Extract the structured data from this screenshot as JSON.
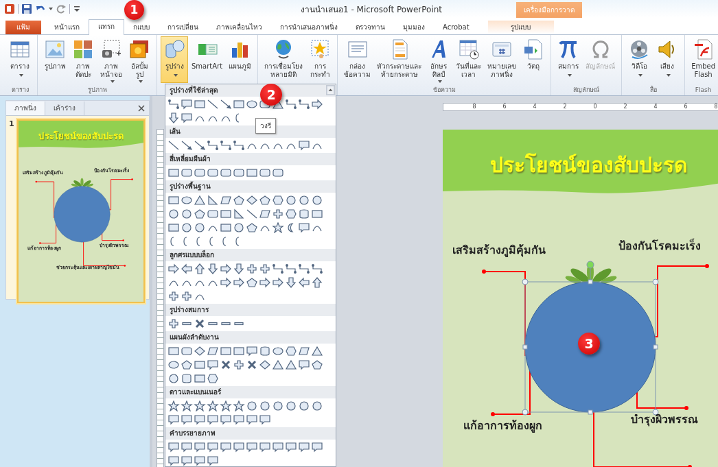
{
  "window": {
    "title": "งานนำเสนอ1 - Microsoft PowerPoint"
  },
  "contextual_group": {
    "label": "เครื่องมือการวาด"
  },
  "tabs": [
    {
      "label": "แฟ้ม",
      "kind": "file",
      "selected": false
    },
    {
      "label": "หน้าแรก",
      "kind": "normal",
      "selected": false
    },
    {
      "label": "แทรก",
      "kind": "normal",
      "selected": true
    },
    {
      "label": "กแบบ",
      "kind": "normal",
      "selected": false
    },
    {
      "label": "การเปลี่ยน",
      "kind": "normal",
      "selected": false
    },
    {
      "label": "ภาพเคลื่อนไหว",
      "kind": "normal",
      "selected": false
    },
    {
      "label": "การนำเสนอภาพนิ่ง",
      "kind": "normal",
      "selected": false
    },
    {
      "label": "ตรวจทาน",
      "kind": "normal",
      "selected": false
    },
    {
      "label": "มุมมอง",
      "kind": "normal",
      "selected": false
    },
    {
      "label": "Acrobat",
      "kind": "normal",
      "selected": false
    },
    {
      "label": "รูปแบบ",
      "kind": "contextual",
      "selected": false
    }
  ],
  "ribbon": {
    "groups": [
      {
        "label": "ตาราง",
        "buttons": [
          {
            "lines": [
              "ตาราง"
            ],
            "dropdown": true,
            "pressed": false,
            "disabled": false
          }
        ]
      },
      {
        "label": "รูปภาพ",
        "buttons": [
          {
            "lines": [
              "รูปภาพ"
            ],
            "dropdown": false,
            "pressed": false,
            "disabled": false
          },
          {
            "lines": [
              "ภาพ",
              "ตัดปะ"
            ],
            "dropdown": false,
            "pressed": false,
            "disabled": false
          },
          {
            "lines": [
              "ภาพ",
              "หน้าจอ"
            ],
            "dropdown": true,
            "pressed": false,
            "disabled": false
          },
          {
            "lines": [
              "อัลบั้ม",
              "รูป"
            ],
            "dropdown": true,
            "pressed": false,
            "disabled": false
          }
        ]
      },
      {
        "buttons": [
          {
            "lines": [
              "รูปร่าง"
            ],
            "dropdown": true,
            "pressed": true,
            "disabled": false
          },
          {
            "lines": [
              "SmartArt"
            ],
            "dropdown": false,
            "pressed": false,
            "disabled": false
          },
          {
            "lines": [
              "แผนภูมิ"
            ],
            "dropdown": false,
            "pressed": false,
            "disabled": false
          }
        ]
      },
      {
        "buttons": [
          {
            "lines": [
              "การเชื่อมโยง",
              "หลายมิติ"
            ],
            "dropdown": false,
            "pressed": false,
            "disabled": false
          },
          {
            "lines": [
              "การ",
              "กระทำ"
            ],
            "dropdown": false,
            "pressed": false,
            "disabled": false
          }
        ]
      },
      {
        "label": "ข้อความ",
        "buttons": [
          {
            "lines": [
              "กล่อง",
              "ข้อความ"
            ],
            "dropdown": false,
            "pressed": false,
            "disabled": false
          },
          {
            "lines": [
              "หัวกระดาษและ",
              "ท้ายกระดาษ"
            ],
            "dropdown": false,
            "pressed": false,
            "disabled": false
          },
          {
            "lines": [
              "อักษร",
              "ศิลป์"
            ],
            "dropdown": true,
            "pressed": false,
            "disabled": false
          },
          {
            "lines": [
              "วันที่และ",
              "เวลา"
            ],
            "dropdown": false,
            "pressed": false,
            "disabled": false
          },
          {
            "lines": [
              "หมายเลข",
              "ภาพนิ่ง"
            ],
            "dropdown": false,
            "pressed": false,
            "disabled": false
          },
          {
            "lines": [
              "วัตถุ"
            ],
            "dropdown": false,
            "pressed": false,
            "disabled": false
          }
        ]
      },
      {
        "label": "สัญลักษณ์",
        "buttons": [
          {
            "lines": [
              "สมการ"
            ],
            "dropdown": true,
            "pressed": false,
            "disabled": false
          },
          {
            "lines": [
              "สัญลักษณ์"
            ],
            "dropdown": false,
            "pressed": false,
            "disabled": true
          }
        ]
      },
      {
        "label": "สื่อ",
        "buttons": [
          {
            "lines": [
              "วิดีโอ"
            ],
            "dropdown": true,
            "pressed": false,
            "disabled": false
          },
          {
            "lines": [
              "เสียง"
            ],
            "dropdown": true,
            "pressed": false,
            "disabled": false
          }
        ]
      },
      {
        "label": "Flash",
        "buttons": [
          {
            "lines": [
              "Embed",
              "Flash"
            ],
            "dropdown": false,
            "pressed": false,
            "disabled": false
          }
        ]
      }
    ]
  },
  "pane": {
    "tabs": [
      {
        "label": "ภาพนิ่ง",
        "selected": true
      },
      {
        "label": "เค้าร่าง",
        "selected": false
      }
    ],
    "slides": [
      {
        "number": "1",
        "selected": true,
        "title": "ประโยชน์ของสับปะรด",
        "labels": [
          "เสริมสร้างภูมิคุ้มกัน",
          "ป้องกันโรคมะเร็ง",
          "แก้อาการท้องผูก",
          "บำรุงผิวพรรณ",
          "ช่วยกระตุ้นและเผาผลาญไขมัน"
        ]
      }
    ]
  },
  "shapes_menu": {
    "sections": [
      {
        "title": "รูปร่างที่ใช้ล่าสุด"
      },
      {
        "title": "เส้น"
      },
      {
        "title": "สี่เหลี่ยมผืนผ้า"
      },
      {
        "title": "รูปร่างพื้นฐาน"
      },
      {
        "title": "ลูกศรแบบบล็อก"
      },
      {
        "title": "รูปร่างสมการ"
      },
      {
        "title": "แผนผังลำดับงาน"
      },
      {
        "title": "ดาวและแบนเนอร์"
      },
      {
        "title": "คำบรรยายภาพ"
      }
    ],
    "tooltip": "วงรี"
  },
  "ruler": {
    "labels": [
      "8",
      "6",
      "4",
      "2",
      "0",
      "2",
      "4",
      "6",
      "8"
    ]
  },
  "slide": {
    "title": "ประโยชน์ของสับปะรด",
    "labels": [
      "เสริมสร้างภูมิคุ้มกัน",
      "ป้องกันโรคมะเร็ง",
      "แก้อาการท้องผูก",
      "บำรุงผิวพรรณ"
    ],
    "shape_selected": true
  },
  "annotations": [
    {
      "label": "1"
    },
    {
      "label": "2"
    },
    {
      "label": "3"
    }
  ]
}
